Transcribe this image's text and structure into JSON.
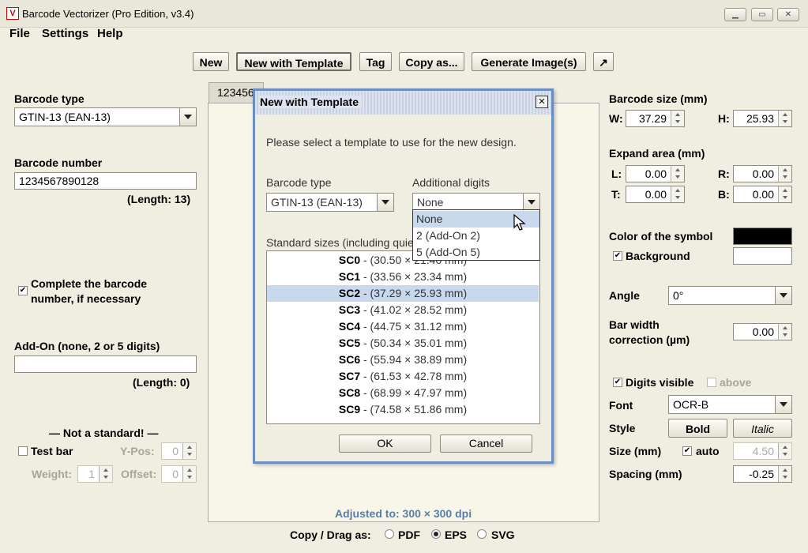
{
  "window": {
    "title": "Barcode Vectorizer (Pro Edition, v3.4)",
    "app_icon": "V"
  },
  "menu": [
    "File",
    "Settings",
    "Help"
  ],
  "toolbar": {
    "new": "New",
    "new_with_template": "New with Template",
    "tag": "Tag",
    "copy_as": "Copy as...",
    "generate": "Generate Image(s)",
    "open_external": "↗"
  },
  "left": {
    "barcode_type_label": "Barcode type",
    "barcode_type_value": "GTIN-13 (EAN-13)",
    "barcode_number_label": "Barcode number",
    "barcode_number_value": "1234567890128",
    "number_length": "(Length: 13)",
    "complete_label_1": "Complete the barcode",
    "complete_label_2": "number, if necessary",
    "complete_checked": "✔",
    "addon_label": "Add-On (none, 2 or 5 digits)",
    "addon_value": "",
    "addon_length": "(Length: 0)",
    "not_standard": "— Not a standard! —",
    "test_bar": "Test bar",
    "ypos_label": "Y-Pos:",
    "ypos_value": "0",
    "weight_label": "Weight:",
    "weight_value": "1",
    "offset_label": "Offset:",
    "offset_value": "0"
  },
  "center": {
    "tab_label": "123456",
    "adjusted": "Adjusted to: 300 × 300 dpi"
  },
  "bottom": {
    "copy_drag": "Copy / Drag as:",
    "opt_pdf": "PDF",
    "opt_eps": "EPS",
    "opt_svg": "SVG"
  },
  "right": {
    "size_label": "Barcode size (mm)",
    "w_label": "W:",
    "w_value": "37.29",
    "h_label": "H:",
    "h_value": "25.93",
    "expand_label": "Expand area (mm)",
    "l_label": "L:",
    "l_value": "0.00",
    "r_label": "R:",
    "r_value": "0.00",
    "t_label": "T:",
    "t_value": "0.00",
    "b_label": "B:",
    "b_value": "0.00",
    "color_label": "Color of the symbol",
    "symbol_color": "#000000",
    "background_label": "Background",
    "background_checked": "✔",
    "background_color": "#ffffff",
    "angle_label": "Angle",
    "angle_value": "0°",
    "bar_width_1": "Bar width",
    "bar_width_2": "correction (µm)",
    "bar_width_value": "0.00",
    "digits_visible": "Digits visible",
    "digits_checked": "✔",
    "above": "above",
    "font_label": "Font",
    "font_value": "OCR-B",
    "style_label": "Style",
    "bold": "Bold",
    "italic": "Italic",
    "size_mm_label": "Size (mm)",
    "auto": "auto",
    "auto_checked": "✔",
    "size_value": "4.50",
    "spacing_label": "Spacing (mm)",
    "spacing_value": "-0.25"
  },
  "dialog": {
    "title": "New with Template",
    "prompt": "Please select a template to use for the new design.",
    "barcode_type_label": "Barcode type",
    "barcode_type_value": "GTIN-13 (EAN-13)",
    "additional_label": "Additional digits",
    "additional_value": "None",
    "dropdown": [
      "None",
      "2 (Add-On 2)",
      "5 (Add-On 5)"
    ],
    "sizes_label": "Standard sizes (including quie",
    "sizes": [
      {
        "code": "SC0",
        "dims": " - (30.50 × 21.40 mm)"
      },
      {
        "code": "SC1",
        "dims": " - (33.56 × 23.34 mm)"
      },
      {
        "code": "SC2",
        "dims": " - (37.29 × 25.93 mm)"
      },
      {
        "code": "SC3",
        "dims": " - (41.02 × 28.52 mm)"
      },
      {
        "code": "SC4",
        "dims": " - (44.75 × 31.12 mm)"
      },
      {
        "code": "SC5",
        "dims": " - (50.34 × 35.01 mm)"
      },
      {
        "code": "SC6",
        "dims": " - (55.94 × 38.89 mm)"
      },
      {
        "code": "SC7",
        "dims": " - (61.53 × 42.78 mm)"
      },
      {
        "code": "SC8",
        "dims": " - (68.99 × 47.97 mm)"
      },
      {
        "code": "SC9",
        "dims": " - (74.58 × 51.86 mm)"
      }
    ],
    "ok": "OK",
    "cancel": "Cancel",
    "close_glyph": "✕"
  }
}
